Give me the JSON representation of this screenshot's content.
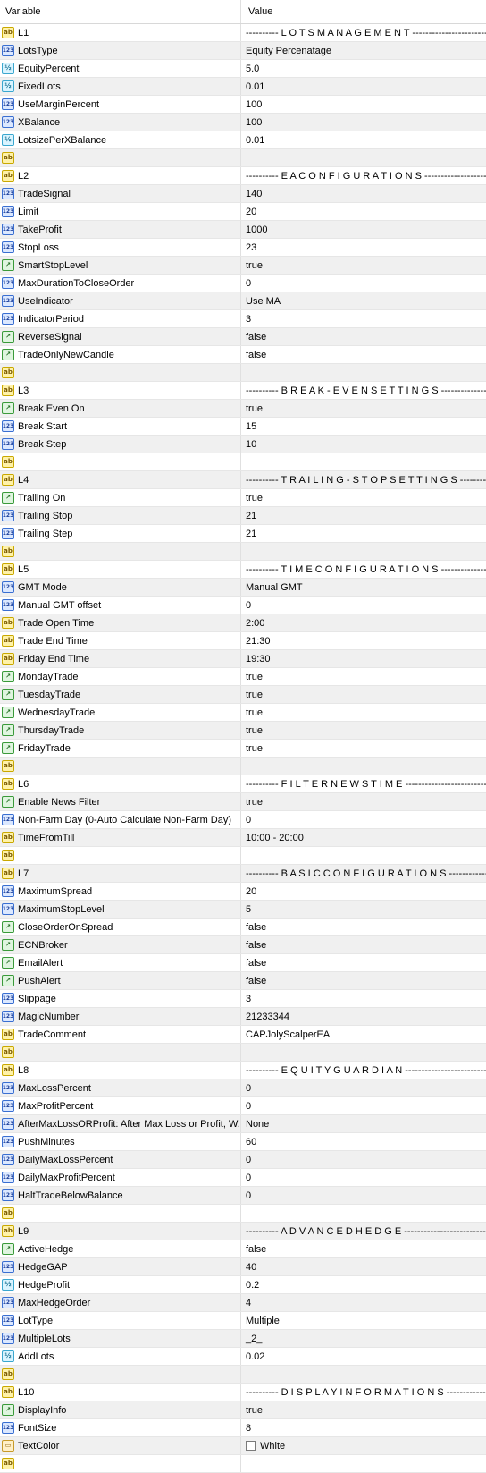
{
  "header": {
    "variable": "Variable",
    "value": "Value"
  },
  "rows": [
    {
      "type": "ab",
      "name": "L1",
      "value": "---------- L O T S   M A N A G E M E N T ------------------------------------"
    },
    {
      "type": "123",
      "name": "LotsType",
      "value": "Equity Percenatage"
    },
    {
      "type": "v2",
      "name": "EquityPercent",
      "value": "5.0"
    },
    {
      "type": "v2",
      "name": "FixedLots",
      "value": "0.01"
    },
    {
      "type": "123",
      "name": "UseMarginPercent",
      "value": "100"
    },
    {
      "type": "123",
      "name": "XBalance",
      "value": "100"
    },
    {
      "type": "v2",
      "name": "LotsizePerXBalance",
      "value": "0.01"
    },
    {
      "type": "ab",
      "name": "",
      "value": ""
    },
    {
      "type": "ab",
      "name": "L2",
      "value": "---------- E A   C O N F I G U R A T I O N S ----------------------------"
    },
    {
      "type": "123",
      "name": "TradeSignal",
      "value": "140"
    },
    {
      "type": "123",
      "name": "Limit",
      "value": "20"
    },
    {
      "type": "123",
      "name": "TakeProfit",
      "value": "1000"
    },
    {
      "type": "123",
      "name": "StopLoss",
      "value": "23"
    },
    {
      "type": "bool",
      "name": "SmartStopLevel",
      "value": "true"
    },
    {
      "type": "123",
      "name": "MaxDurationToCloseOrder",
      "value": "0"
    },
    {
      "type": "123",
      "name": "UseIndicator",
      "value": "Use MA"
    },
    {
      "type": "123",
      "name": "IndicatorPeriod",
      "value": "3"
    },
    {
      "type": "bool",
      "name": "ReverseSignal",
      "value": "false"
    },
    {
      "type": "bool",
      "name": "TradeOnlyNewCandle",
      "value": "false"
    },
    {
      "type": "ab",
      "name": "",
      "value": ""
    },
    {
      "type": "ab",
      "name": "L3",
      "value": "---------- B R E A K - E V E N   S E T T I N G S ----------------"
    },
    {
      "type": "bool",
      "name": "Break Even On",
      "value": "true"
    },
    {
      "type": "123",
      "name": "Break Start",
      "value": "15"
    },
    {
      "type": "123",
      "name": "Break Step",
      "value": "10"
    },
    {
      "type": "ab",
      "name": "",
      "value": ""
    },
    {
      "type": "ab",
      "name": "L4",
      "value": "---------- T R A I L I N G - S T O P   S E T T I N G S --------"
    },
    {
      "type": "bool",
      "name": "Trailing On",
      "value": "true"
    },
    {
      "type": "123",
      "name": "Trailing Stop",
      "value": "21"
    },
    {
      "type": "123",
      "name": "Trailing Step",
      "value": "21"
    },
    {
      "type": "ab",
      "name": "",
      "value": ""
    },
    {
      "type": "ab",
      "name": "L5",
      "value": "---------- T I M E   C O N F I G U R A T I O N S ----------------"
    },
    {
      "type": "123",
      "name": "GMT Mode",
      "value": "Manual GMT"
    },
    {
      "type": "123",
      "name": "Manual GMT offset",
      "value": "0"
    },
    {
      "type": "ab",
      "name": "Trade Open Time",
      "value": "2:00"
    },
    {
      "type": "ab",
      "name": "Trade End Time",
      "value": "21:30"
    },
    {
      "type": "ab",
      "name": "Friday End Time",
      "value": "19:30"
    },
    {
      "type": "bool",
      "name": "MondayTrade",
      "value": "true"
    },
    {
      "type": "bool",
      "name": "TuesdayTrade",
      "value": "true"
    },
    {
      "type": "bool",
      "name": "WednesdayTrade",
      "value": "true"
    },
    {
      "type": "bool",
      "name": "ThursdayTrade",
      "value": "true"
    },
    {
      "type": "bool",
      "name": "FridayTrade",
      "value": "true"
    },
    {
      "type": "ab",
      "name": "",
      "value": ""
    },
    {
      "type": "ab",
      "name": "L6",
      "value": "---------- F I L T E R   N E W S   T I M E ------------------------------"
    },
    {
      "type": "bool",
      "name": "Enable News Filter",
      "value": "true"
    },
    {
      "type": "123",
      "name": "Non-Farm Day (0-Auto Calculate Non-Farm Day)",
      "value": "0"
    },
    {
      "type": "ab",
      "name": "TimeFromTill",
      "value": "10:00 - 20:00"
    },
    {
      "type": "ab",
      "name": "",
      "value": ""
    },
    {
      "type": "ab",
      "name": "L7",
      "value": "---------- B A S I C   C O N F I G U R A T I O N S ------------"
    },
    {
      "type": "123",
      "name": "MaximumSpread",
      "value": "20"
    },
    {
      "type": "123",
      "name": "MaximumStopLevel",
      "value": "5"
    },
    {
      "type": "bool",
      "name": "CloseOrderOnSpread",
      "value": "false"
    },
    {
      "type": "bool",
      "name": "ECNBroker",
      "value": "false"
    },
    {
      "type": "bool",
      "name": "EmailAlert",
      "value": "false"
    },
    {
      "type": "bool",
      "name": "PushAlert",
      "value": "false"
    },
    {
      "type": "123",
      "name": "Slippage",
      "value": "3"
    },
    {
      "type": "123",
      "name": "MagicNumber",
      "value": "21233344"
    },
    {
      "type": "ab",
      "name": "TradeComment",
      "value": "CAPJolyScalperEA"
    },
    {
      "type": "ab",
      "name": "",
      "value": ""
    },
    {
      "type": "ab",
      "name": "L8",
      "value": "---------- E Q U I T Y   G U A R D I A N ------------------------------"
    },
    {
      "type": "123",
      "name": "MaxLossPercent",
      "value": "0"
    },
    {
      "type": "123",
      "name": "MaxProfitPercent",
      "value": "0"
    },
    {
      "type": "123",
      "name": "AfterMaxLossORProfit: After Max Loss or Profit, W...",
      "value": "None"
    },
    {
      "type": "123",
      "name": "PushMinutes",
      "value": "60"
    },
    {
      "type": "123",
      "name": "DailyMaxLossPercent",
      "value": "0"
    },
    {
      "type": "123",
      "name": "DailyMaxProfitPercent",
      "value": "0"
    },
    {
      "type": "123",
      "name": "HaltTradeBelowBalance",
      "value": "0"
    },
    {
      "type": "ab",
      "name": "",
      "value": ""
    },
    {
      "type": "ab",
      "name": "L9",
      "value": "---------- A D V A N C E D   H E D G E ------------------------------------"
    },
    {
      "type": "bool",
      "name": "ActiveHedge",
      "value": "false"
    },
    {
      "type": "123",
      "name": "HedgeGAP",
      "value": "40"
    },
    {
      "type": "v2",
      "name": "HedgeProfit",
      "value": "0.2"
    },
    {
      "type": "123",
      "name": "MaxHedgeOrder",
      "value": "4"
    },
    {
      "type": "123",
      "name": "LotType",
      "value": "Multiple"
    },
    {
      "type": "123",
      "name": "MultipleLots",
      "value": "_2_"
    },
    {
      "type": "v2",
      "name": "AddLots",
      "value": "0.02"
    },
    {
      "type": "ab",
      "name": "",
      "value": ""
    },
    {
      "type": "ab",
      "name": "L10",
      "value": "---------- D I S P L A Y   I N F O R M A T I O N S ------------"
    },
    {
      "type": "bool",
      "name": "DisplayInfo",
      "value": "true"
    },
    {
      "type": "123",
      "name": "FontSize",
      "value": "8"
    },
    {
      "type": "color",
      "name": "TextColor",
      "value": "White"
    },
    {
      "type": "ab",
      "name": "",
      "value": ""
    }
  ],
  "icons": {
    "ab": {
      "glyph": "ab",
      "semantic": "string-type-icon"
    },
    "123": {
      "glyph": "123",
      "semantic": "integer-type-icon"
    },
    "v2": {
      "glyph": "½",
      "semantic": "double-type-icon"
    },
    "bool": {
      "glyph": "↗",
      "semantic": "bool-type-icon"
    },
    "color": {
      "glyph": "▭",
      "semantic": "color-type-icon"
    }
  }
}
